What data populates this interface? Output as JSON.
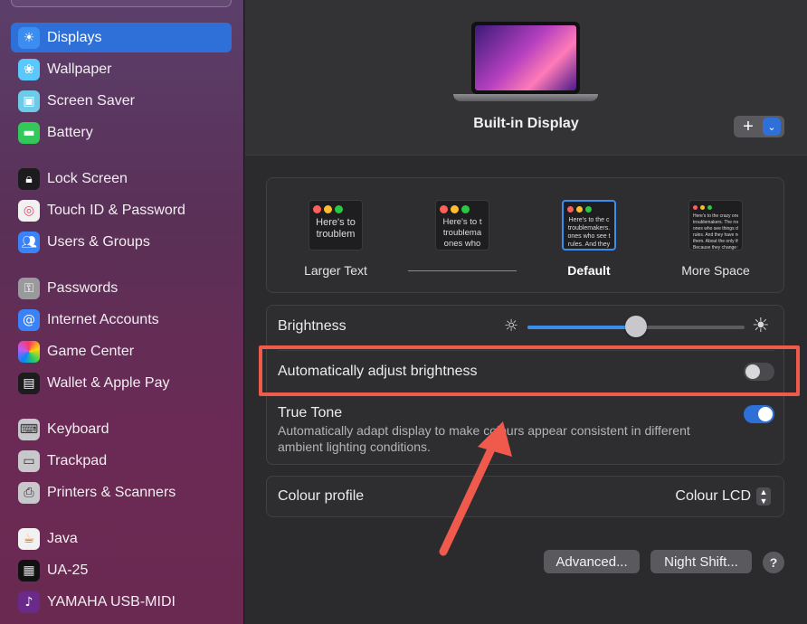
{
  "sidebar": {
    "items": [
      {
        "label": "Displays",
        "icon": "sun-icon",
        "active": true
      },
      {
        "label": "Wallpaper",
        "icon": "flower-icon"
      },
      {
        "label": "Screen Saver",
        "icon": "screen-icon"
      },
      {
        "label": "Battery",
        "icon": "battery-icon"
      },
      {
        "label": "Lock Screen",
        "icon": "lock-icon"
      },
      {
        "label": "Touch ID & Password",
        "icon": "fingerprint-icon"
      },
      {
        "label": "Users & Groups",
        "icon": "users-icon"
      },
      {
        "label": "Passwords",
        "icon": "key-icon"
      },
      {
        "label": "Internet Accounts",
        "icon": "at-icon"
      },
      {
        "label": "Game Center",
        "icon": "game-center-icon"
      },
      {
        "label": "Wallet & Apple Pay",
        "icon": "wallet-icon"
      },
      {
        "label": "Keyboard",
        "icon": "keyboard-icon"
      },
      {
        "label": "Trackpad",
        "icon": "trackpad-icon"
      },
      {
        "label": "Printers & Scanners",
        "icon": "printer-icon"
      },
      {
        "label": "Java",
        "icon": "java-icon"
      },
      {
        "label": "UA-25",
        "icon": "ua25-icon"
      },
      {
        "label": "YAMAHA USB-MIDI",
        "icon": "yamaha-icon"
      }
    ]
  },
  "display": {
    "name": "Built-in Display",
    "add_symbol": "+",
    "chevron": "⌄"
  },
  "resolution": {
    "options": [
      {
        "label": "Larger Text",
        "preview": "Here's to\ntroublem",
        "selected": false
      },
      {
        "label": "",
        "preview": "Here's to t\ntroublema\nones who",
        "selected": false
      },
      {
        "label": "Default",
        "preview": "Here's to the c\ntroublemakers.\nones who see t\nrules. And they",
        "selected": true
      },
      {
        "label": "More Space",
        "preview": "Here's to the crazy one\ntroublemakers. The rou\nones who see things diff\nrules. And they have no\nthem. About the only thi\nBecause they change th",
        "selected": false
      }
    ]
  },
  "settings": {
    "brightness_label": "Brightness",
    "brightness_level": 0.5,
    "auto_brightness_label": "Automatically adjust brightness",
    "auto_brightness_on": false,
    "true_tone_label": "True Tone",
    "true_tone_desc": "Automatically adapt display to make colours appear consistent in different ambient lighting conditions.",
    "true_tone_on": true,
    "colour_profile_label": "Colour profile",
    "colour_profile_value": "Colour LCD"
  },
  "buttons": {
    "advanced": "Advanced...",
    "night_shift": "Night Shift...",
    "help": "?"
  },
  "colors": {
    "accent": "#2f6fd8",
    "annotation": "#ef5a4c"
  }
}
